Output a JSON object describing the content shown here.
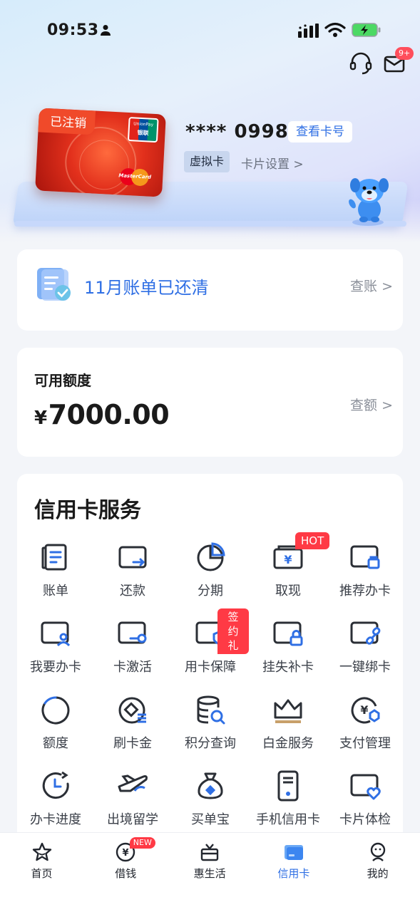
{
  "status_bar": {
    "time": "09:53"
  },
  "header": {
    "mail_badge": "9+"
  },
  "card": {
    "cancel_tag": "已注销",
    "union_pay_en": "UnionPay",
    "union_pay_cn": "银联",
    "mastercard": "MasterCard",
    "number": "**** 0998",
    "view_button": "查看卡号",
    "virtual_tag": "虚拟卡",
    "settings_link": "卡片设置 >"
  },
  "bill": {
    "status": "11月账单已还清",
    "link": "查账 >"
  },
  "quota": {
    "label": "可用额度",
    "currency": "¥",
    "amount": "7000.00",
    "link": "查额 >"
  },
  "services": {
    "title": "信用卡服务",
    "items": [
      {
        "label": "账单",
        "icon": "bill-icon"
      },
      {
        "label": "还款",
        "icon": "repay-icon"
      },
      {
        "label": "分期",
        "icon": "installment-icon"
      },
      {
        "label": "取现",
        "icon": "cash-icon",
        "tag": "HOT"
      },
      {
        "label": "推荐办卡",
        "icon": "recommend-card-icon"
      },
      {
        "label": "我要办卡",
        "icon": "apply-card-icon"
      },
      {
        "label": "卡激活",
        "icon": "activate-card-icon"
      },
      {
        "label": "用卡保障",
        "icon": "card-protection-icon",
        "tag": "签约礼"
      },
      {
        "label": "挂失补卡",
        "icon": "report-loss-icon"
      },
      {
        "label": "一键绑卡",
        "icon": "bind-card-icon"
      },
      {
        "label": "额度",
        "icon": "limit-icon"
      },
      {
        "label": "刷卡金",
        "icon": "swipe-bonus-icon"
      },
      {
        "label": "积分查询",
        "icon": "points-icon"
      },
      {
        "label": "白金服务",
        "icon": "platinum-icon"
      },
      {
        "label": "支付管理",
        "icon": "payment-manage-icon"
      },
      {
        "label": "办卡进度",
        "icon": "progress-icon"
      },
      {
        "label": "出境留学",
        "icon": "travel-icon"
      },
      {
        "label": "买单宝",
        "icon": "pay-bag-icon"
      },
      {
        "label": "手机信用卡",
        "icon": "phone-card-icon"
      },
      {
        "label": "卡片体检",
        "icon": "card-check-icon"
      }
    ]
  },
  "nav": {
    "items": [
      {
        "label": "首页",
        "icon": "home-icon"
      },
      {
        "label": "借钱",
        "icon": "borrow-icon",
        "badge": "NEW"
      },
      {
        "label": "惠生活",
        "icon": "life-icon"
      },
      {
        "label": "信用卡",
        "icon": "credit-card-icon",
        "active": true
      },
      {
        "label": "我的",
        "icon": "profile-icon"
      }
    ]
  },
  "colors": {
    "accent": "#2f6fe4",
    "tag_red": "#ff3a45",
    "card_red": "#e2301c"
  }
}
